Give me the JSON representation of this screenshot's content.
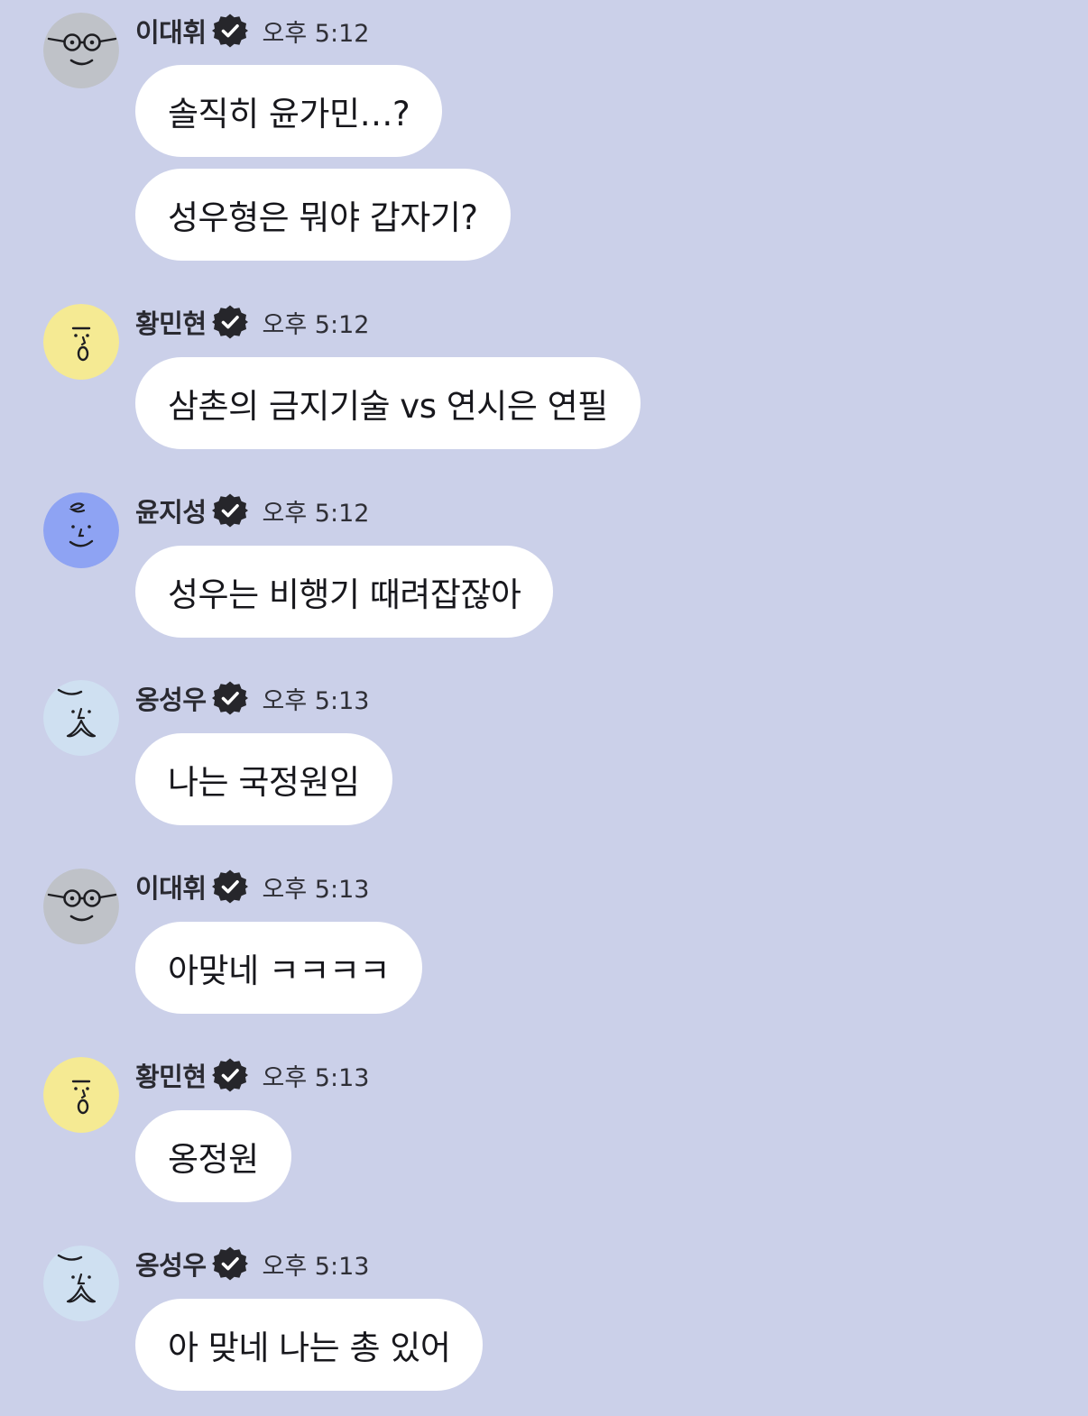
{
  "messages": [
    {
      "sender": "이대휘",
      "avatar": "glasses-face-avatar",
      "time": "오후 5:12",
      "bubbles": [
        "솔직히 윤가민…?",
        "성우형은 뭐야 갑자기?"
      ]
    },
    {
      "sender": "황민현",
      "avatar": "yellow-o-face-avatar",
      "time": "오후 5:12",
      "bubbles": [
        "삼촌의 금지기술 vs 연시은 연필"
      ]
    },
    {
      "sender": "윤지성",
      "avatar": "blue-smile-face-avatar",
      "time": "오후 5:12",
      "bubbles": [
        "성우는 비행기 때려잡잖아"
      ]
    },
    {
      "sender": "옹성우",
      "avatar": "mustache-face-avatar",
      "time": "오후 5:13",
      "bubbles": [
        "나는 국정원임"
      ]
    },
    {
      "sender": "이대휘",
      "avatar": "glasses-face-avatar",
      "time": "오후 5:13",
      "bubbles": [
        "아맞네 ㅋㅋㅋㅋ"
      ]
    },
    {
      "sender": "황민현",
      "avatar": "yellow-o-face-avatar",
      "time": "오후 5:13",
      "bubbles": [
        "옹정원"
      ]
    },
    {
      "sender": "옹성우",
      "avatar": "mustache-face-avatar",
      "time": "오후 5:13",
      "bubbles": [
        "아 맞네 나는 총 있어"
      ]
    }
  ],
  "colors": {
    "background": "#cbd0e9",
    "bubble": "#ffffff",
    "verified_badge": "#26262b",
    "avatar_gray": "#bfc2c8",
    "avatar_yellow": "#f5ea93",
    "avatar_blue": "#8ea3f3",
    "avatar_lightblue": "#cfe0f1"
  }
}
